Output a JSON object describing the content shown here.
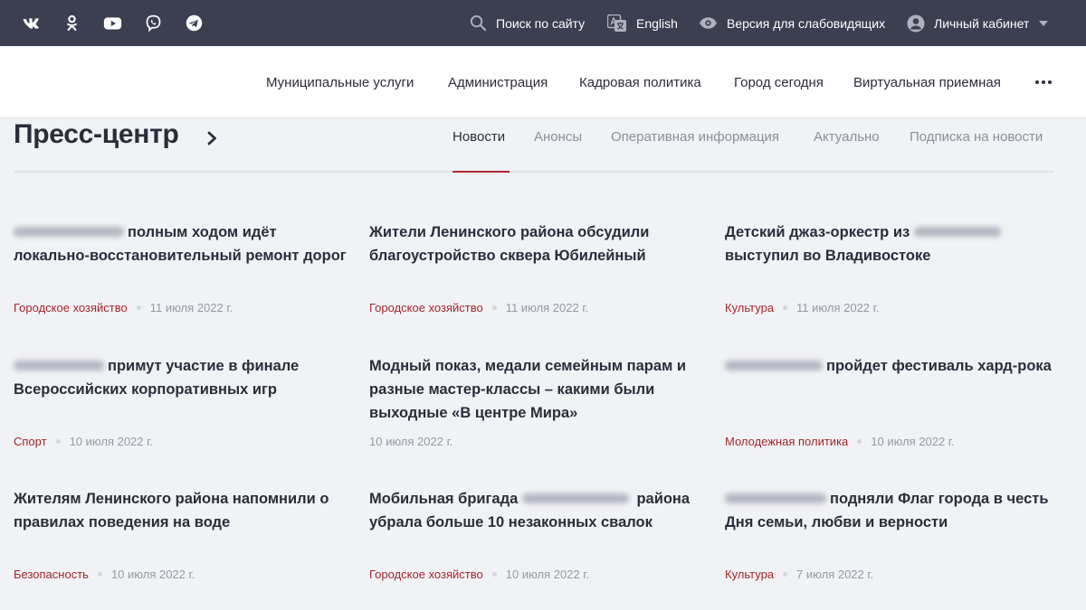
{
  "topbar": {
    "social": [
      {
        "name": "vk-icon"
      },
      {
        "name": "odnoklassniki-icon"
      },
      {
        "name": "youtube-icon"
      },
      {
        "name": "viber-icon"
      },
      {
        "name": "telegram-icon"
      }
    ],
    "search_label": "Поиск по сайту",
    "lang_label": "English",
    "accessibility_label": "Версия для слабовидящих",
    "account_label": "Личный кабинет"
  },
  "nav": {
    "items": [
      "Муниципальные услуги",
      "Администрация",
      "Кадровая политика",
      "Город сегодня",
      "Виртуальная приемная"
    ]
  },
  "press": {
    "title": "Пресс-центр",
    "tabs": [
      "Новости",
      "Анонсы",
      "Оперативная информация",
      "Актуально",
      "Подписка на новости"
    ],
    "active_tab": "Новости"
  },
  "news": [
    {
      "title": "полным ходом идёт локально-восстановительный ремонт дорог",
      "category": "Городское хозяйство",
      "date": "11 июля 2022 г."
    },
    {
      "title": "Жители Ленинского района обсудили благоустройство сквера Юбилейный",
      "category": "Городское хозяйство",
      "date": "11 июля 2022 г."
    },
    {
      "title": "Детский джаз-оркестр из выступил во Владивостоке",
      "title_a": "Детский джаз-оркестр из",
      "title_b": "выступил во Владивостоке",
      "category": "Культура",
      "date": "11 июля 2022 г."
    },
    {
      "title": "примут участие в финале Всероссийских корпоративных игр",
      "category": "Спорт",
      "date": "10 июля 2022 г."
    },
    {
      "title": "Модный показ, медали семейным парам и разные мастер-классы – какими были выходные «В центре Мира»",
      "category": "",
      "date": "10 июля 2022 г."
    },
    {
      "title": "пройдет фестиваль хард-рока",
      "category": "Молодежная политика",
      "date": "10 июля 2022 г."
    },
    {
      "title": "Жителям Ленинского района напомнили о правилах поведения на воде",
      "category": "Безопасность",
      "date": "10 июля 2022 г."
    },
    {
      "title": "Мобильная бригада района убрала больше 10 незаконных свалок",
      "title_a": "Мобильная бригада",
      "title_b": "района убрала больше 10 незаконных свалок",
      "category": "Городское хозяйство",
      "date": "10 июля 2022 г."
    },
    {
      "title": "подняли Флаг города в честь Дня семьи, любви и верности",
      "category": "Культура",
      "date": "7 июля 2022 г."
    }
  ],
  "colors": {
    "topbar": "#3b3f50",
    "accent": "#b3282d",
    "category": "#a3262b",
    "background": "#f1f2f6"
  }
}
